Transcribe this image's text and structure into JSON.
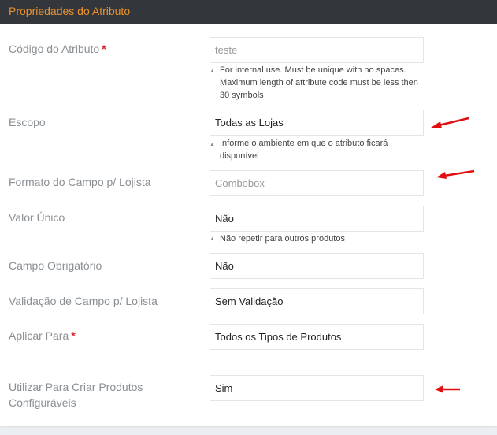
{
  "panel": {
    "title": "Propriedades do Atributo"
  },
  "fields": [
    {
      "label": "Código do Atributo",
      "required": "*",
      "value": "teste",
      "hint": "For internal use. Must be unique with no spaces. Maximum length of attribute code must be less then 30 symbols"
    },
    {
      "label": "Escopo",
      "value": "Todas as Lojas",
      "hint": "Informe o ambiente em que o atributo ficará disponível"
    },
    {
      "label": "Formato do Campo p/ Lojista",
      "value": "Combobox"
    },
    {
      "label": "Valor Único",
      "value": "Não",
      "hint": "Não repetir para outros produtos"
    },
    {
      "label": "Campo Obrigatório",
      "value": "Não"
    },
    {
      "label": "Validação de Campo p/ Lojista",
      "value": "Sem Validação"
    },
    {
      "label": "Aplicar Para",
      "required": "*",
      "value": "Todos os Tipos de Produtos"
    },
    {
      "label": "Utilizar Para Criar Produtos Configuráveis",
      "value": "Sim"
    }
  ],
  "icons": {
    "hint": "triangle-up-icon",
    "annotation": "red-arrow-icon"
  },
  "colors": {
    "header_bg": "#33363b",
    "title": "#e8922f",
    "required": "#d9232d",
    "arrow": "#e01010"
  }
}
